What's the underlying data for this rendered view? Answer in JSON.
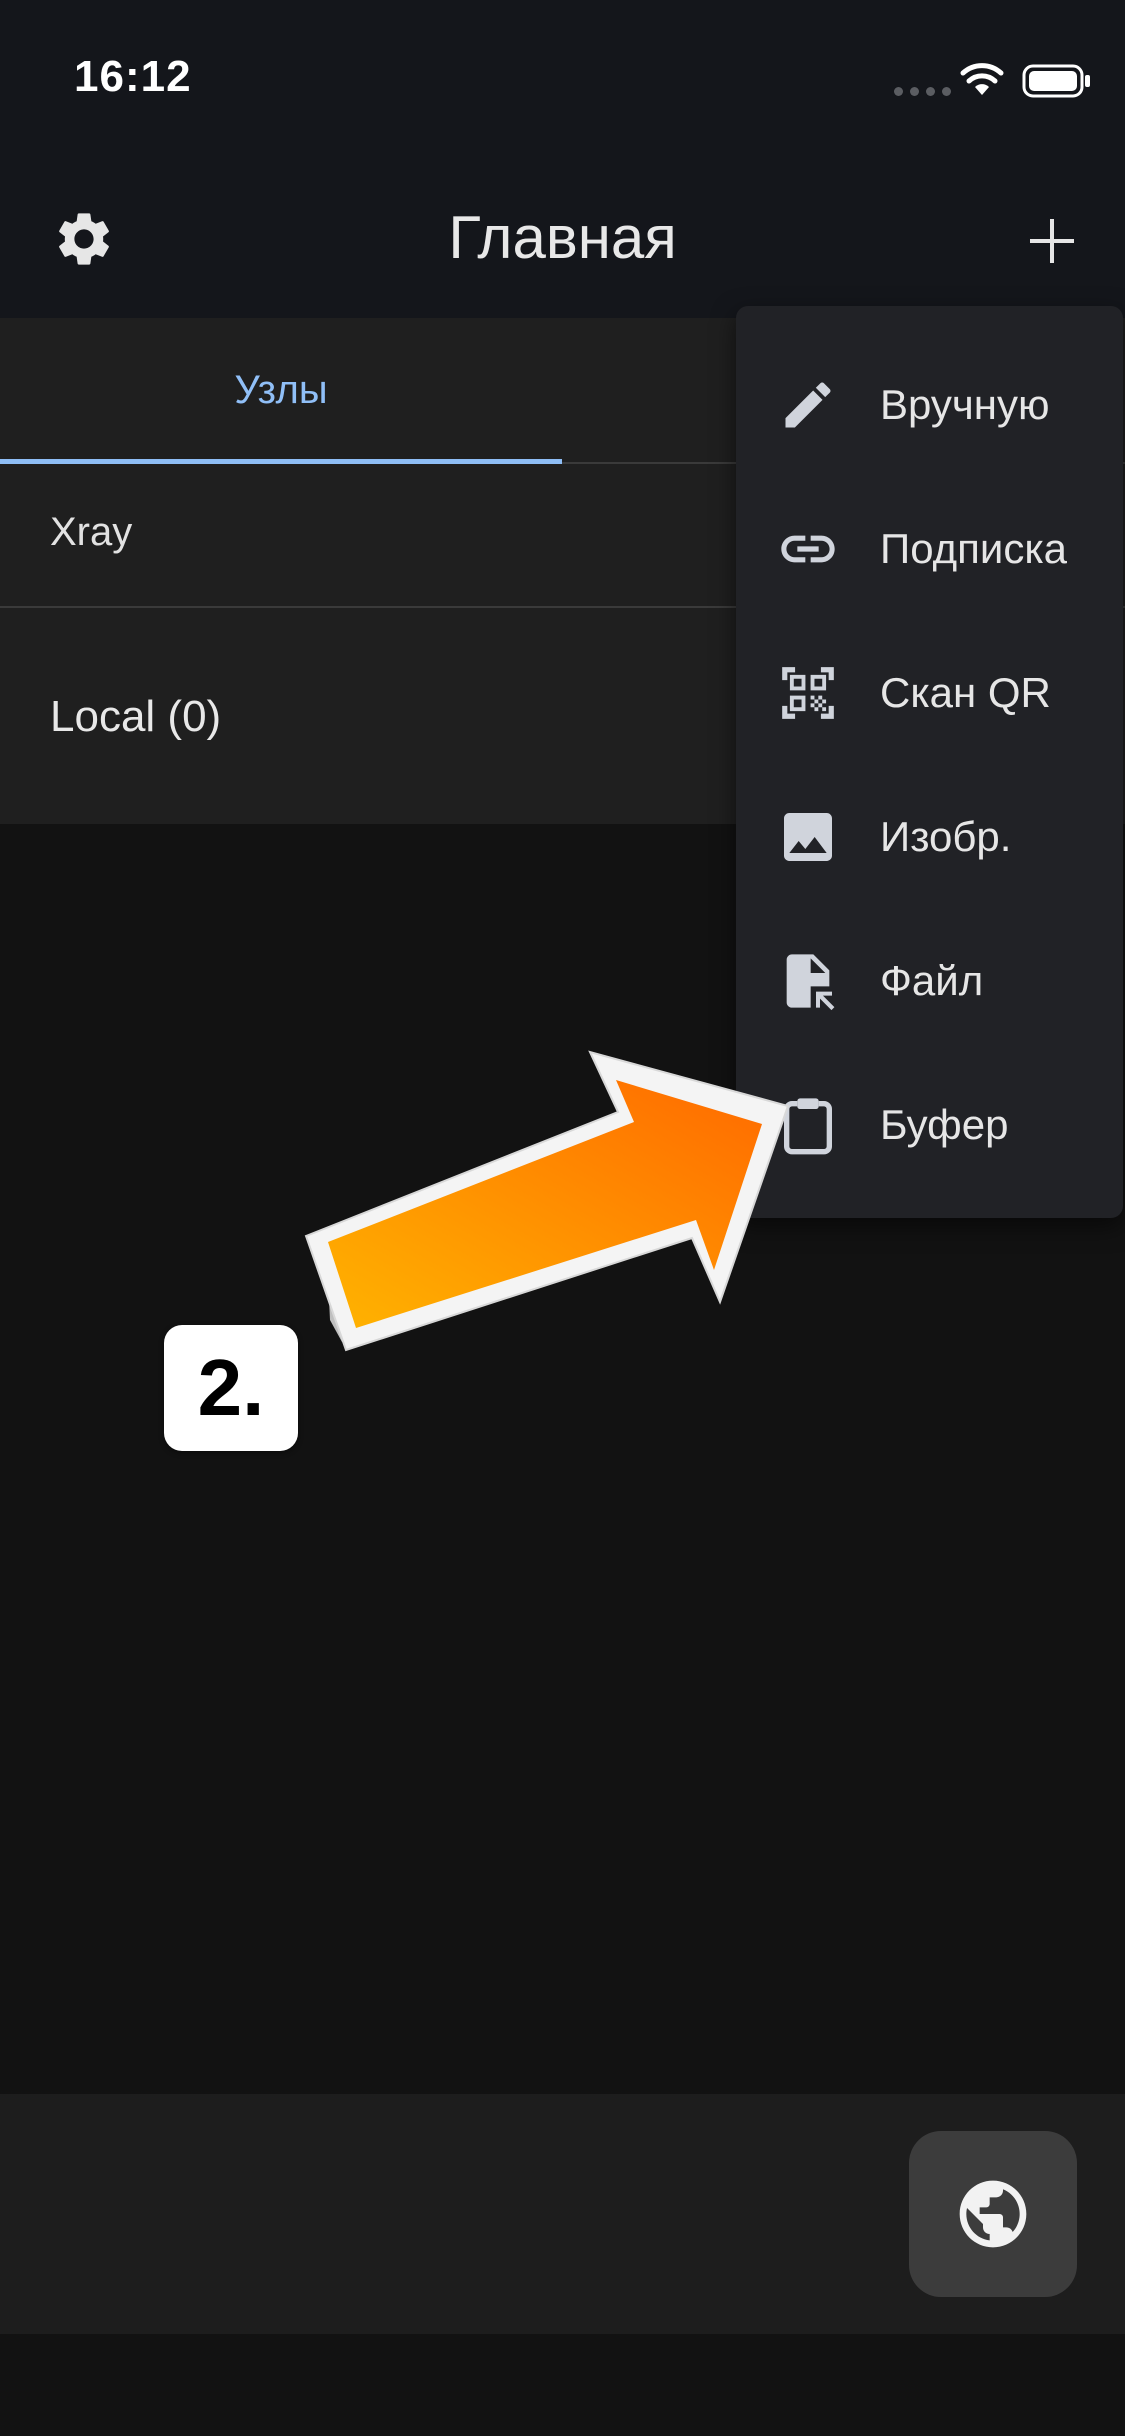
{
  "status_bar": {
    "time": "16:12"
  },
  "app_bar": {
    "title": "Главная",
    "left_icon": "gear-icon",
    "right_icon": "plus-icon"
  },
  "tabs": [
    {
      "label": "Узлы",
      "active": true
    }
  ],
  "list": {
    "rows": [
      {
        "label": "Xray"
      },
      {
        "label": "Local (0)"
      }
    ]
  },
  "menu": {
    "items": [
      {
        "label": "Вручную",
        "icon": "pencil-icon"
      },
      {
        "label": "Подписка",
        "icon": "link-icon"
      },
      {
        "label": "Скан QR",
        "icon": "qr-scan-icon"
      },
      {
        "label": "Изобр.",
        "icon": "image-icon"
      },
      {
        "label": "Файл",
        "icon": "file-icon"
      },
      {
        "label": "Буфер",
        "icon": "clipboard-icon"
      }
    ]
  },
  "fab": {
    "icon": "globe-icon"
  },
  "annotation": {
    "step": "2.",
    "arrow_color": "#ff8a00"
  },
  "colors": {
    "background": "#121212",
    "surface": "#1f1f1f",
    "appbar": "#14161b",
    "menu": "#212226",
    "accent": "#8ebdf5"
  }
}
